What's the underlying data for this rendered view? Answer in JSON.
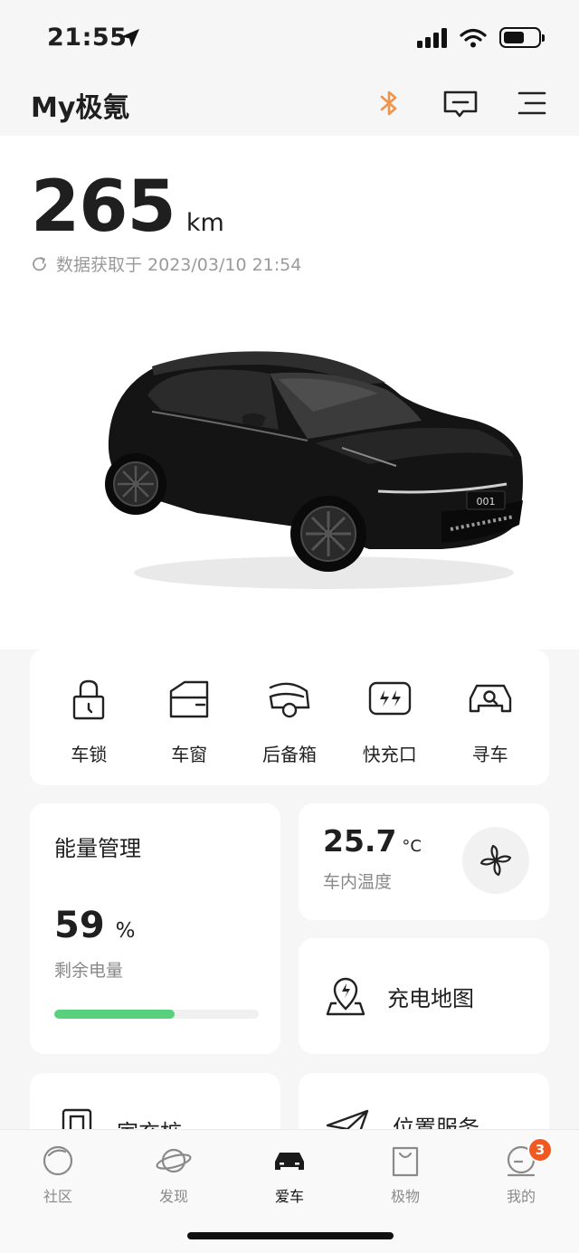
{
  "status_bar": {
    "time": "21:55"
  },
  "header": {
    "title": "My极氪",
    "icons": [
      "bluetooth-icon",
      "message-icon",
      "menu-icon"
    ],
    "bluetooth_color": "#f0944a"
  },
  "hero": {
    "range_value": "265",
    "range_unit": "km",
    "data_time": "数据获取于 2023/03/10 21:54",
    "plate": "001"
  },
  "quick_actions": [
    {
      "label": "车锁",
      "icon": "lock-icon"
    },
    {
      "label": "车窗",
      "icon": "window-icon"
    },
    {
      "label": "后备箱",
      "icon": "trunk-icon"
    },
    {
      "label": "快充口",
      "icon": "charge-port-icon"
    },
    {
      "label": "寻车",
      "icon": "find-car-icon"
    }
  ],
  "energy": {
    "title": "能量管理",
    "value": "59",
    "unit": "%",
    "subtitle": "剩余电量",
    "level": 0.59,
    "bar_color": "#58d07c"
  },
  "climate": {
    "value": "25.7",
    "unit": "°C",
    "subtitle": "车内温度"
  },
  "charge_map": {
    "label": "充电地图"
  },
  "home_pile": {
    "label": "家充桩"
  },
  "location_service": {
    "label": "位置服务"
  },
  "tabbar": {
    "tabs": [
      {
        "label": "社区",
        "icon": "community-icon"
      },
      {
        "label": "发现",
        "icon": "discover-icon"
      },
      {
        "label": "爱车",
        "icon": "car-icon"
      },
      {
        "label": "极物",
        "icon": "shop-bag-icon"
      },
      {
        "label": "我的",
        "icon": "profile-icon"
      }
    ],
    "active": "爱车",
    "badge_count": "3"
  }
}
